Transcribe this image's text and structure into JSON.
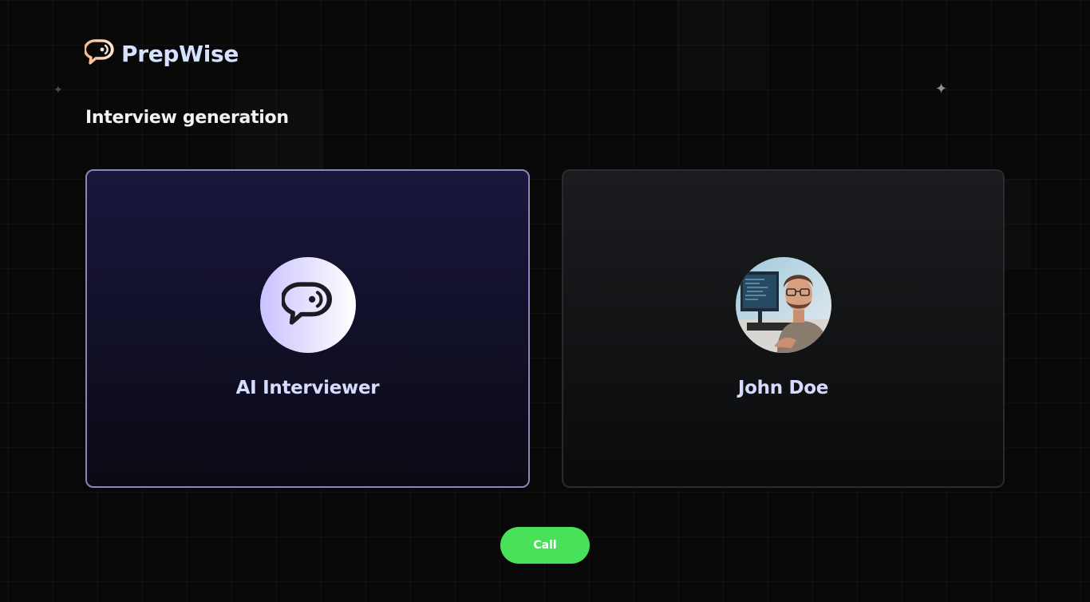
{
  "app": {
    "name": "PrepWise"
  },
  "page": {
    "title": "Interview generation"
  },
  "interviewer": {
    "name": "AI Interviewer",
    "icon": "chat-bubble-icon"
  },
  "user": {
    "name": "John Doe",
    "avatar": "user-photo"
  },
  "actions": {
    "call_label": "Call"
  },
  "colors": {
    "background": "#080808",
    "logo_text": "#d6e0ff",
    "logo_icon": "#f5c3a0",
    "card_label": "#d6dcff",
    "ai_card_border": "#8a86b8",
    "call_button": "#49e05a"
  }
}
